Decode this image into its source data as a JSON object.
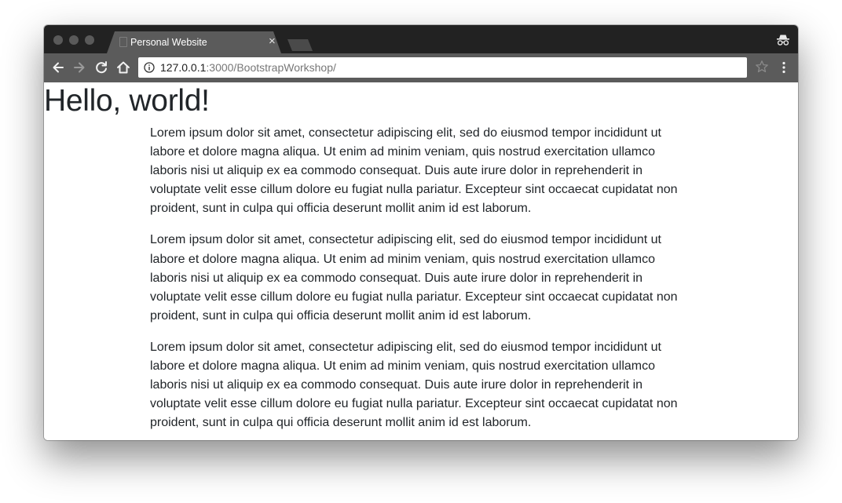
{
  "browser": {
    "tab": {
      "title": "Personal Website",
      "close_glyph": "×"
    },
    "address_bar": {
      "host": "127.0.0.1",
      "rest": ":3000/BootstrapWorkshop/"
    },
    "icons": {
      "back": "back-arrow-icon",
      "forward": "forward-arrow-icon",
      "reload": "reload-icon",
      "home": "home-icon",
      "info": "info-icon",
      "bookmark": "star-icon",
      "menu": "kebab-menu-icon",
      "incognito": "incognito-icon"
    },
    "colors": {
      "tabstrip": "#222222",
      "toolbar": "#5b5b5b",
      "text": "#212529"
    }
  },
  "page": {
    "heading": "Hello, world!",
    "paragraphs": [
      "Lorem ipsum dolor sit amet, consectetur adipiscing elit, sed do eiusmod tempor incididunt ut labore et dolore magna aliqua. Ut enim ad minim veniam, quis nostrud exercitation ullamco laboris nisi ut aliquip ex ea commodo consequat. Duis aute irure dolor in reprehenderit in voluptate velit esse cillum dolore eu fugiat nulla pariatur. Excepteur sint occaecat cupidatat non proident, sunt in culpa qui officia deserunt mollit anim id est laborum.",
      "Lorem ipsum dolor sit amet, consectetur adipiscing elit, sed do eiusmod tempor incididunt ut labore et dolore magna aliqua. Ut enim ad minim veniam, quis nostrud exercitation ullamco laboris nisi ut aliquip ex ea commodo consequat. Duis aute irure dolor in reprehenderit in voluptate velit esse cillum dolore eu fugiat nulla pariatur. Excepteur sint occaecat cupidatat non proident, sunt in culpa qui officia deserunt mollit anim id est laborum.",
      "Lorem ipsum dolor sit amet, consectetur adipiscing elit, sed do eiusmod tempor incididunt ut labore et dolore magna aliqua. Ut enim ad minim veniam, quis nostrud exercitation ullamco laboris nisi ut aliquip ex ea commodo consequat. Duis aute irure dolor in reprehenderit in voluptate velit esse cillum dolore eu fugiat nulla pariatur. Excepteur sint occaecat cupidatat non proident, sunt in culpa qui officia deserunt mollit anim id est laborum."
    ]
  }
}
